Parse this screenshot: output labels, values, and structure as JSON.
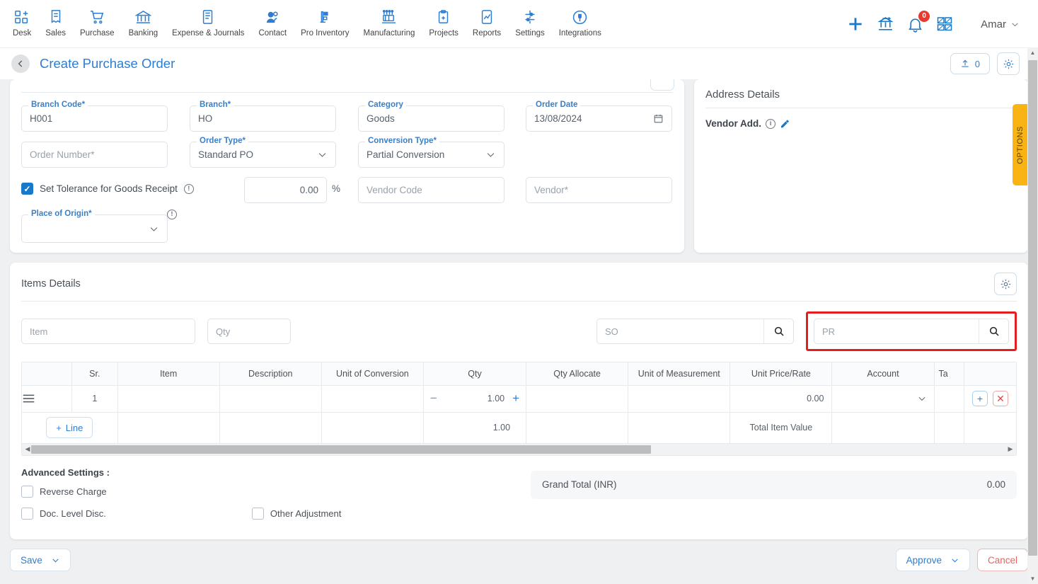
{
  "topnav": {
    "items": [
      {
        "label": "Desk",
        "icon": "desk-icon"
      },
      {
        "label": "Sales",
        "icon": "sales-icon"
      },
      {
        "label": "Purchase",
        "icon": "purchase-cart-icon"
      },
      {
        "label": "Banking",
        "icon": "bank-icon"
      },
      {
        "label": "Expense & Journals",
        "icon": "journal-icon"
      },
      {
        "label": "Contact",
        "icon": "contact-icon"
      },
      {
        "label": "Pro Inventory",
        "icon": "inventory-icon"
      },
      {
        "label": "Manufacturing",
        "icon": "manufacturing-icon"
      },
      {
        "label": "Projects",
        "icon": "projects-icon"
      },
      {
        "label": "Reports",
        "icon": "reports-icon"
      },
      {
        "label": "Settings",
        "icon": "settings-sliders-icon"
      },
      {
        "label": "Integrations",
        "icon": "integrations-icon"
      }
    ],
    "notification_count": "0",
    "user_name": "Amar",
    "accent_color": "#2d7dd2",
    "badge_color": "#e8392c"
  },
  "titlebar": {
    "title": "Create Purchase Order",
    "attachment_count": "0"
  },
  "form": {
    "branch_code": {
      "label": "Branch Code",
      "required": true,
      "value": "H001"
    },
    "branch": {
      "label": "Branch",
      "required": true,
      "value": "HO"
    },
    "category": {
      "label": "Category",
      "required": false,
      "value": "Goods"
    },
    "order_date": {
      "label": "Order Date",
      "required": false,
      "value": "13/08/2024"
    },
    "order_number": {
      "label": "",
      "required": true,
      "placeholder": "Order Number",
      "value": ""
    },
    "order_type": {
      "label": "Order Type",
      "required": true,
      "value": "Standard PO"
    },
    "conversion_type": {
      "label": "Conversion Type",
      "required": true,
      "value": "Partial Conversion"
    },
    "tolerance": {
      "label": "Set Tolerance for Goods Receipt",
      "checked": true,
      "value": "0.00",
      "unit": "%"
    },
    "vendor_code": {
      "placeholder": "Vendor Code",
      "value": ""
    },
    "vendor": {
      "placeholder": "Vendor",
      "required": true,
      "value": ""
    },
    "place_of_origin": {
      "label": "Place of Origin",
      "required": true,
      "value": ""
    }
  },
  "address_panel": {
    "title": "Address Details",
    "vendor_address_label": "Vendor Add.",
    "options_tab": "OPTIONS"
  },
  "items": {
    "section_title": "Items Details",
    "item_filter_placeholder": "Item",
    "qty_filter_placeholder": "Qty",
    "so_search_placeholder": "SO",
    "pr_search_placeholder": "PR",
    "columns": [
      "",
      "Sr.",
      "Item",
      "Description",
      "Unit of Conversion",
      "Qty",
      "Qty Allocate",
      "Unit of Measurement",
      "Unit Price/Rate",
      "Account",
      "Ta"
    ],
    "rows": [
      {
        "sr": "1",
        "item": "",
        "description": "",
        "unit_of_conversion": "",
        "qty": "1.00",
        "qty_allocate": "",
        "unit_of_measurement": "",
        "unit_price_rate": "0.00",
        "account": "",
        "tax": ""
      }
    ],
    "add_line_label": "Line",
    "footer_qty_total": "1.00",
    "footer_total_label": "Total Item Value"
  },
  "advanced": {
    "title": "Advanced Settings :",
    "reverse_charge": {
      "label": "Reverse Charge",
      "checked": false
    },
    "doc_level_disc": {
      "label": "Doc. Level Disc.",
      "checked": false
    },
    "other_adjustment": {
      "label": "Other Adjustment",
      "checked": false
    }
  },
  "totals": {
    "grand_total_label": "Grand Total (INR)",
    "grand_total_value": "0.00"
  },
  "footer": {
    "save_label": "Save",
    "approve_label": "Approve",
    "cancel_label": "Cancel"
  }
}
